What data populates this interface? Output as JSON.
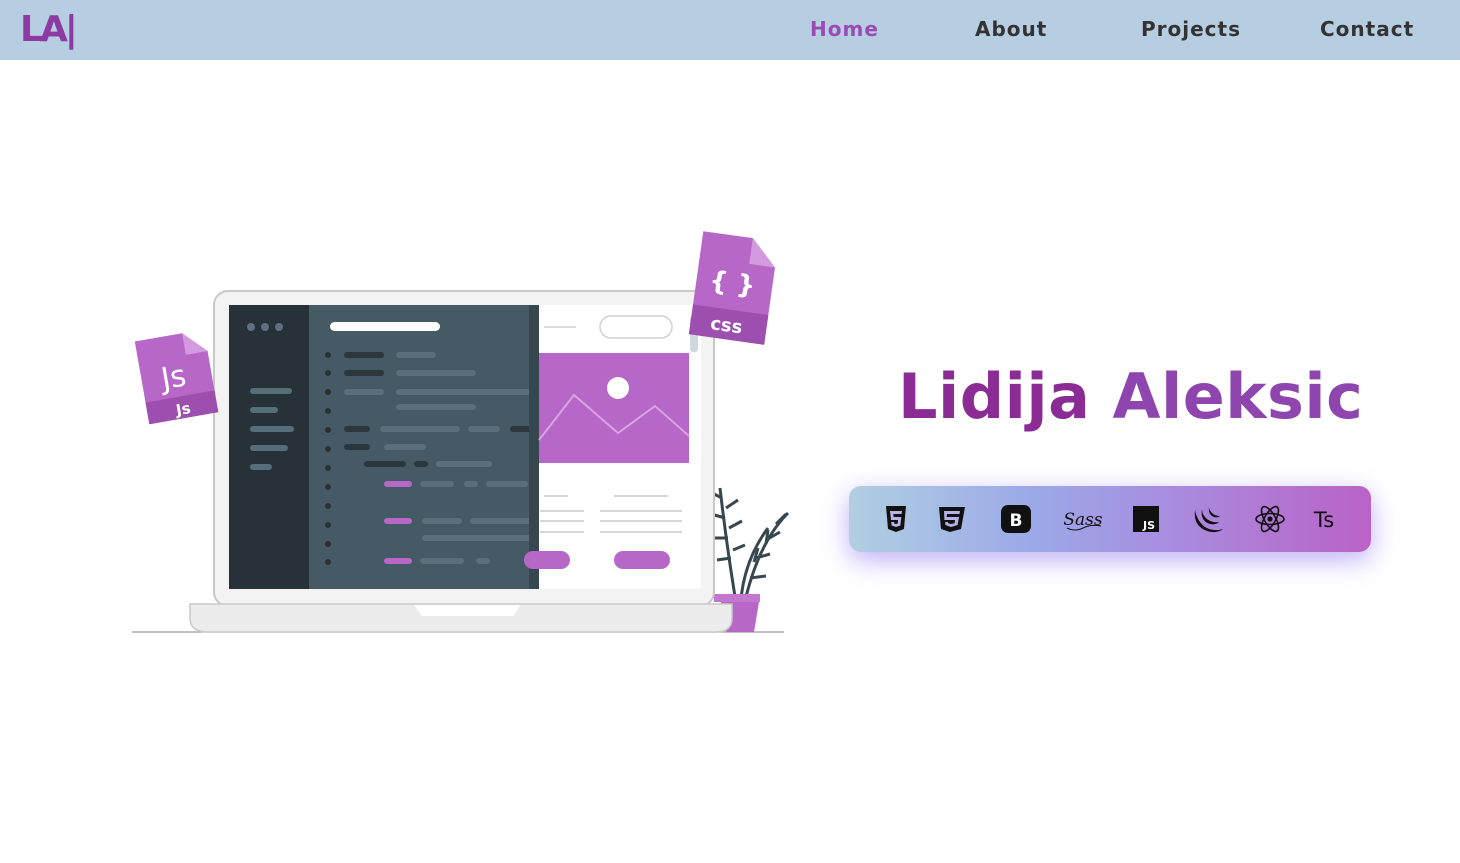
{
  "nav": {
    "logo": "LA|",
    "links": [
      {
        "label": "Home",
        "active": true
      },
      {
        "label": "About",
        "active": false
      },
      {
        "label": "Projects",
        "active": false
      },
      {
        "label": "Contact",
        "active": false
      }
    ]
  },
  "hero": {
    "first_name": "Lidija",
    "last_name": "Aleksic",
    "illustration": {
      "js_file_label": "Js",
      "js_file_small_label": "Js",
      "css_file_braces": "{ }",
      "css_file_label": "css"
    },
    "tech_icons": [
      "html5-icon",
      "css3-icon",
      "bootstrap-icon",
      "sass-icon",
      "javascript-icon",
      "jquery-icon",
      "react-icon",
      "typescript-icon"
    ],
    "tech_icon_text": {
      "bootstrap": "B",
      "sass": "Sass",
      "javascript": "JS",
      "typescript": "Ts"
    }
  },
  "colors": {
    "navbar_bg": "#b7cde2",
    "accent_purple": "#8e3aa3",
    "active_link": "#9a4bb6",
    "illustration_purple": "#b767c8"
  }
}
